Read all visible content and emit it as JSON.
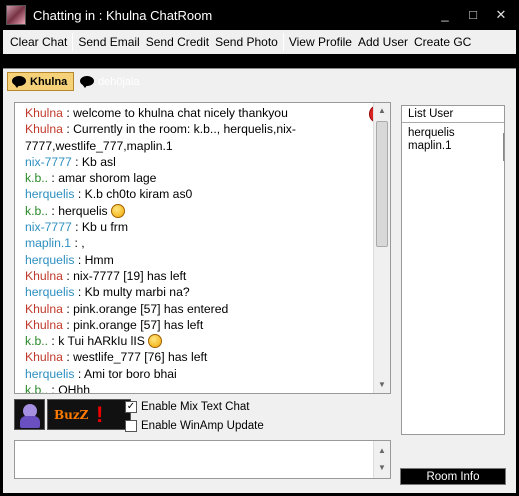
{
  "window": {
    "title": "Chatting in : Khulna ChatRoom",
    "controls": {
      "minimize": "_",
      "maximize": "□",
      "close": "✕"
    }
  },
  "menu": {
    "items": [
      "Clear Chat",
      "Send Email",
      "Send Credit",
      "Send Photo",
      "View Profile",
      "Add User",
      "Create GC"
    ]
  },
  "tabs": [
    {
      "label": "Khulna",
      "active": true
    },
    {
      "label": "deh0jala",
      "active": false
    }
  ],
  "chat": {
    "lines": [
      {
        "nick": "Khulna",
        "color": "#c0392b",
        "text": " : welcome to khulna chat nicely thankyou"
      },
      {
        "nick": "Khulna",
        "color": "#c0392b",
        "text": " : Currently in the room: k.b.., herquelis,nix-7777,westlife_777,maplin.1"
      },
      {
        "nick": "nix-7777",
        "color": "#2f8fc0",
        "text": " : Kb asl"
      },
      {
        "nick": "k.b..",
        "color": "#2a8a2a",
        "text": " : amar shorom lage"
      },
      {
        "nick": "herquelis",
        "color": "#2f8fc0",
        "text": " : K.b ch0to kiram as0"
      },
      {
        "nick": "k.b..",
        "color": "#2a8a2a",
        "text": " : herquelis ",
        "emoticon": true
      },
      {
        "nick": "nix-7777",
        "color": "#2f8fc0",
        "text": " : Kb u frm"
      },
      {
        "nick": "maplin.1",
        "color": "#2f8fc0",
        "text": " : ,"
      },
      {
        "nick": "herquelis",
        "color": "#2f8fc0",
        "text": " : Hmm"
      },
      {
        "nick": "Khulna",
        "color": "#c0392b",
        "text": " : nix-7777 [19] has left"
      },
      {
        "nick": "herquelis",
        "color": "#2f8fc0",
        "text": " : Kb multy marbi na?"
      },
      {
        "nick": "Khulna",
        "color": "#c0392b",
        "text": " : pink.orange [57] has entered"
      },
      {
        "nick": "Khulna",
        "color": "#c0392b",
        "text": " : pink.orange [57] has left"
      },
      {
        "nick": "k.b..",
        "color": "#2a8a2a",
        "text": " : k Tui hARkIu lIS ",
        "emoticon": true
      },
      {
        "nick": "Khulna",
        "color": "#c0392b",
        "text": " : westlife_777 [76] has left"
      },
      {
        "nick": "herquelis",
        "color": "#2f8fc0",
        "text": " : Ami tor boro bhai"
      },
      {
        "nick": "k.b..",
        "color": "#2a8a2a",
        "text": " : OHhh"
      }
    ]
  },
  "options": {
    "mix_text": {
      "label": "Enable Mix Text Chat",
      "checked": true
    },
    "winamp": {
      "label": "Enable WinAmp Update",
      "checked": false
    }
  },
  "buzz": {
    "label": "BuzZ",
    "mark": "!"
  },
  "user_list": {
    "header": "List User",
    "users": [
      "herquelis",
      "maplin.1"
    ]
  },
  "room_info_label": "Room Info"
}
